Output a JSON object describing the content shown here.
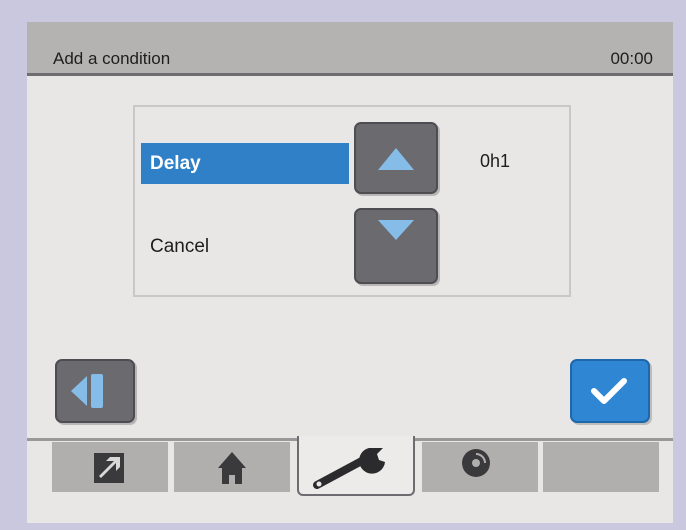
{
  "header": {
    "title": "Add a condition",
    "clock": "00:00"
  },
  "options": [
    {
      "label": "Delay",
      "selected": true
    },
    {
      "label": "Cancel",
      "selected": false
    }
  ],
  "value": "0h1",
  "buttons": {
    "up": "up-arrow-icon",
    "down": "down-arrow-icon",
    "back": "back-icon",
    "confirm": "check-icon"
  },
  "tabs": [
    {
      "icon": "shortcut-arrow-icon",
      "active": false
    },
    {
      "icon": "home-icon",
      "active": false
    },
    {
      "icon": "wrench-icon",
      "active": true
    },
    {
      "icon": "disc-icon",
      "active": false
    },
    {
      "icon": "",
      "active": false
    }
  ],
  "colors": {
    "accent": "#2f80c7",
    "button_grey": "#6b6a6e",
    "arrow": "#86bde8"
  }
}
